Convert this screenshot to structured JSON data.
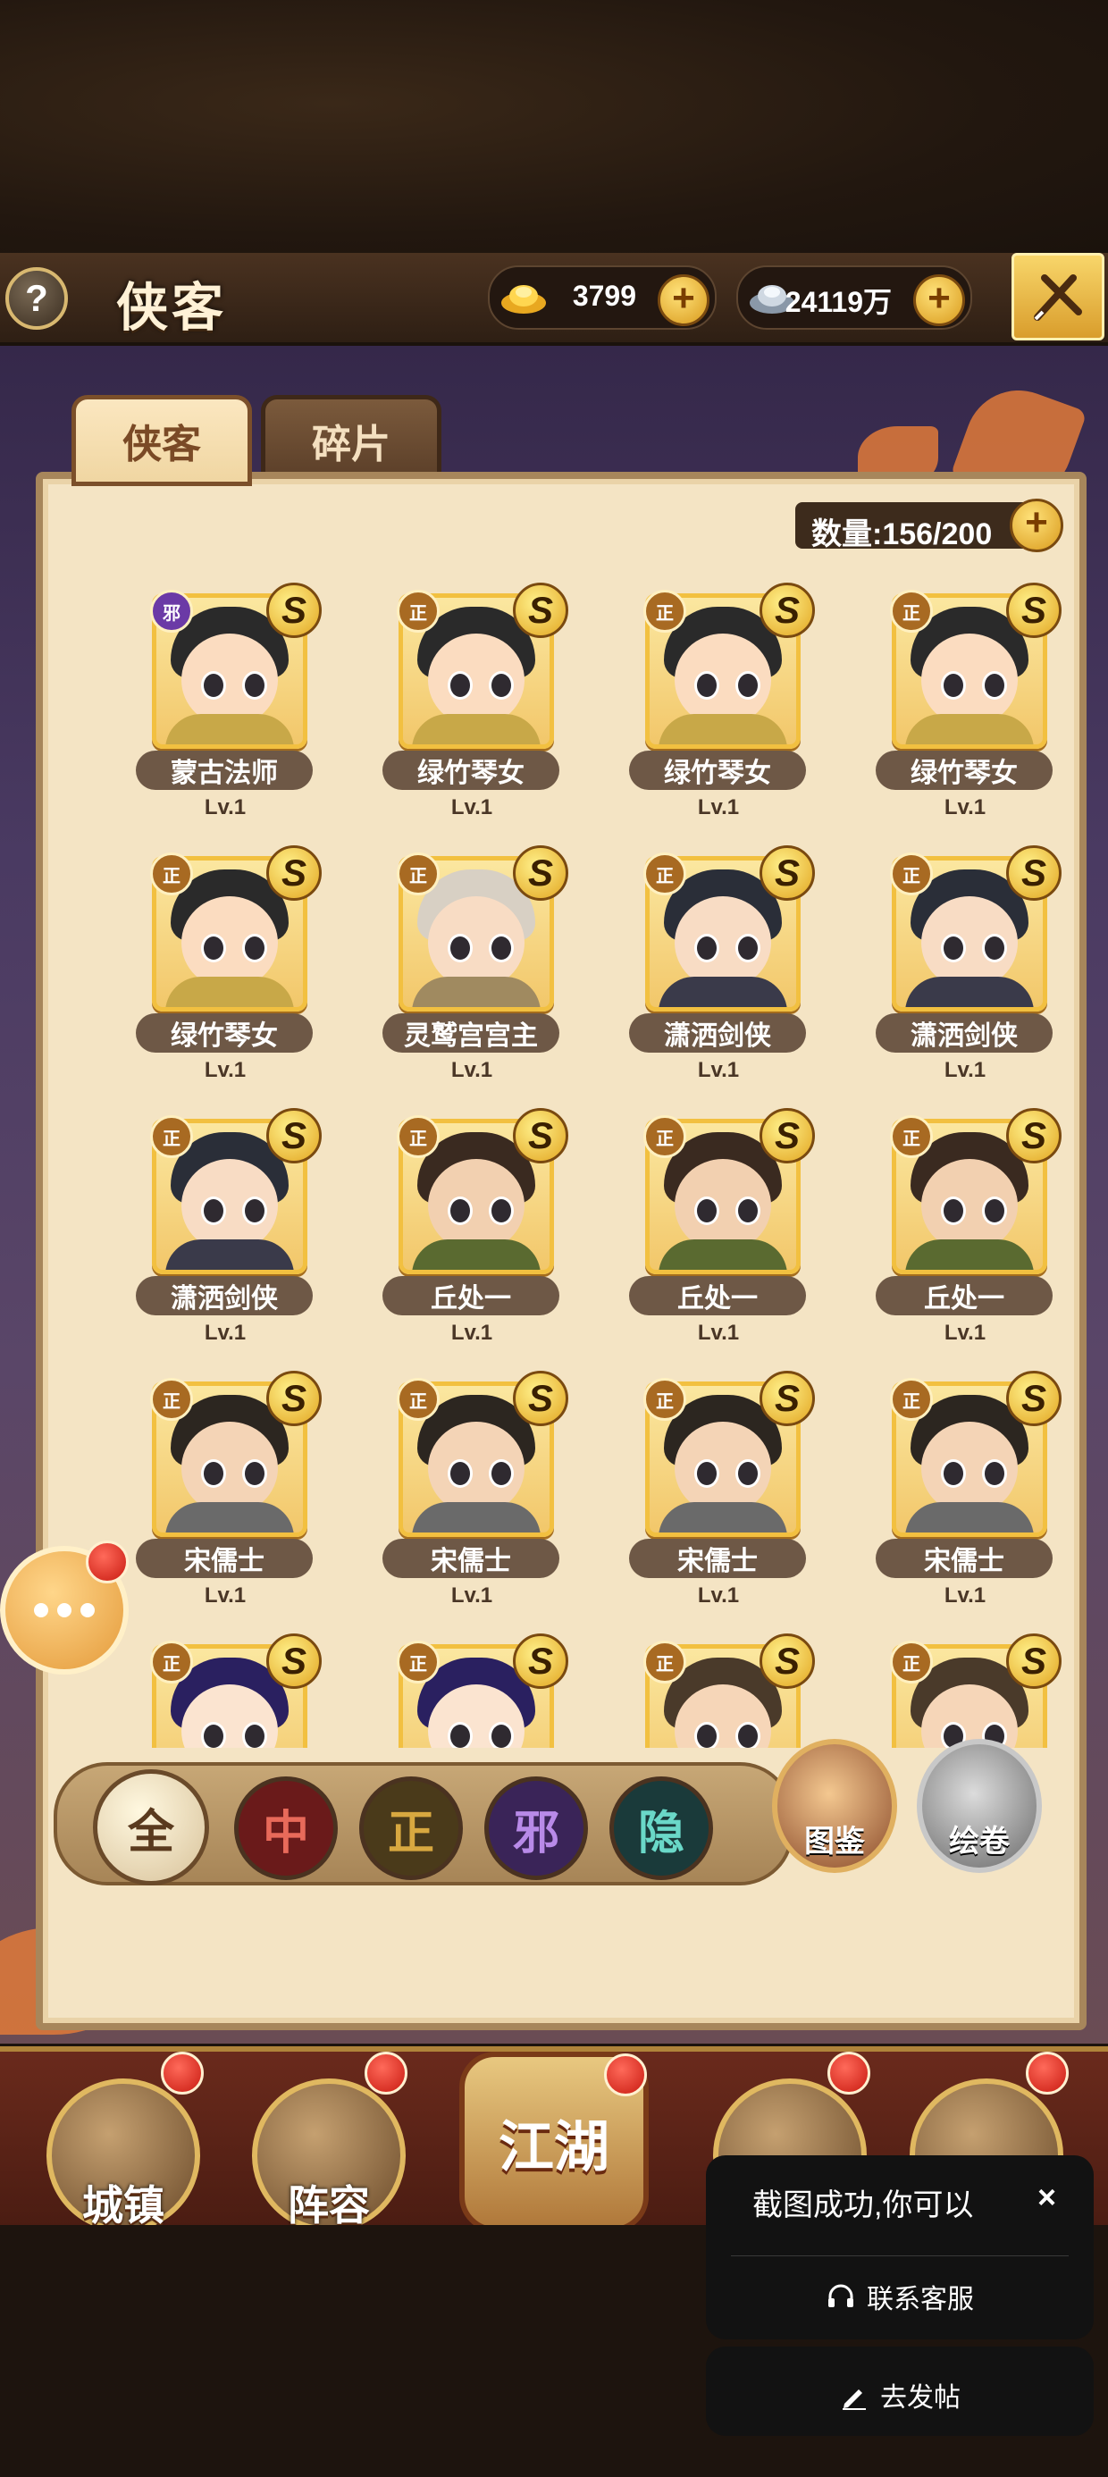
{
  "header": {
    "title": "侠客",
    "help_label": "?",
    "gold_value": "3799",
    "silver_value": "24119万"
  },
  "tabs": [
    {
      "label": "侠客",
      "active": true
    },
    {
      "label": "碎片",
      "active": false
    }
  ],
  "roster": {
    "count_label": "数量:156/200"
  },
  "heroes": [
    {
      "name": "蒙古法师",
      "level": "Lv.1",
      "align": "邪",
      "grade": "S"
    },
    {
      "name": "绿竹琴女",
      "level": "Lv.1",
      "align": "正",
      "grade": "S"
    },
    {
      "name": "绿竹琴女",
      "level": "Lv.1",
      "align": "正",
      "grade": "S"
    },
    {
      "name": "绿竹琴女",
      "level": "Lv.1",
      "align": "正",
      "grade": "S"
    },
    {
      "name": "绿竹琴女",
      "level": "Lv.1",
      "align": "正",
      "grade": "S"
    },
    {
      "name": "灵鹫宫宫主",
      "level": "Lv.1",
      "align": "正",
      "grade": "S"
    },
    {
      "name": "潇洒剑侠",
      "level": "Lv.1",
      "align": "正",
      "grade": "S"
    },
    {
      "name": "潇洒剑侠",
      "level": "Lv.1",
      "align": "正",
      "grade": "S"
    },
    {
      "name": "潇洒剑侠",
      "level": "Lv.1",
      "align": "正",
      "grade": "S"
    },
    {
      "name": "丘处一",
      "level": "Lv.1",
      "align": "正",
      "grade": "S"
    },
    {
      "name": "丘处一",
      "level": "Lv.1",
      "align": "正",
      "grade": "S"
    },
    {
      "name": "丘处一",
      "level": "Lv.1",
      "align": "正",
      "grade": "S"
    },
    {
      "name": "宋儒士",
      "level": "Lv.1",
      "align": "正",
      "grade": "S"
    },
    {
      "name": "宋儒士",
      "level": "Lv.1",
      "align": "正",
      "grade": "S"
    },
    {
      "name": "宋儒士",
      "level": "Lv.1",
      "align": "正",
      "grade": "S"
    },
    {
      "name": "宋儒士",
      "level": "Lv.1",
      "align": "正",
      "grade": "S"
    },
    {
      "name": "",
      "level": "",
      "align": "正",
      "grade": "S"
    },
    {
      "name": "",
      "level": "",
      "align": "正",
      "grade": "S"
    },
    {
      "name": "",
      "level": "",
      "align": "正",
      "grade": "S"
    },
    {
      "name": "",
      "level": "",
      "align": "正",
      "grade": "S"
    }
  ],
  "filters": [
    {
      "label": "全",
      "active": true
    },
    {
      "label": "中",
      "active": false
    },
    {
      "label": "正",
      "active": false
    },
    {
      "label": "邪",
      "active": false
    },
    {
      "label": "隐",
      "active": false
    }
  ],
  "side_buttons": {
    "atlas_label": "图鉴",
    "scroll_label": "绘卷"
  },
  "bottom_nav": {
    "town_label": "城镇",
    "lineup_label": "阵容",
    "jianghu_label": "江湖"
  },
  "toast": {
    "message": "截图成功,你可以",
    "close_label": "×",
    "contact_label": "联系客服",
    "post_label": "去发帖"
  },
  "colors": {
    "good_badge": "#a86a22",
    "evil_badge": "#6b3aa6",
    "gold_accent": "#f2c040",
    "panel_bg": "#f4e4c4"
  }
}
